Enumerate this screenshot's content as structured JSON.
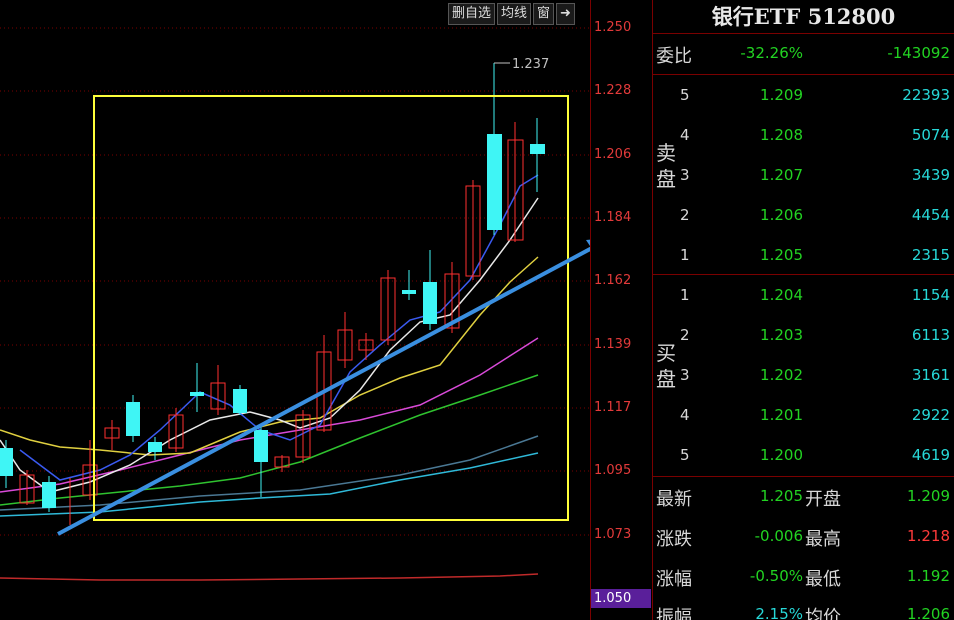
{
  "toolbar": {
    "buttons": [
      "删自选",
      "均线",
      "窗",
      "➜"
    ]
  },
  "price_axis": {
    "ticks": [
      "1.250",
      "1.228",
      "1.206",
      "1.184",
      "1.162",
      "1.139",
      "1.117",
      "1.095",
      "1.073",
      "1.050"
    ],
    "current_label": "1.050"
  },
  "chart": {
    "peak_label": "1.237",
    "colors": {
      "up": "#ff3030",
      "down": "#3ff5f5",
      "box": "#ffff3a",
      "arrow": "#3a8fe0"
    }
  },
  "quote": {
    "title": "银行ETF 512800",
    "weibi": {
      "label": "委比",
      "pct": "-32.26%",
      "diff": "-143092"
    },
    "sell_label": "卖盘",
    "buy_label": "买盘",
    "sell": [
      {
        "lvl": "5",
        "price": "1.209",
        "vol": "22393"
      },
      {
        "lvl": "4",
        "price": "1.208",
        "vol": "5074"
      },
      {
        "lvl": "3",
        "price": "1.207",
        "vol": "3439"
      },
      {
        "lvl": "2",
        "price": "1.206",
        "vol": "4454"
      },
      {
        "lvl": "1",
        "price": "1.205",
        "vol": "2315"
      }
    ],
    "buy": [
      {
        "lvl": "1",
        "price": "1.204",
        "vol": "1154"
      },
      {
        "lvl": "2",
        "price": "1.203",
        "vol": "6113"
      },
      {
        "lvl": "3",
        "price": "1.202",
        "vol": "3161"
      },
      {
        "lvl": "4",
        "price": "1.201",
        "vol": "2922"
      },
      {
        "lvl": "5",
        "price": "1.200",
        "vol": "4619"
      }
    ],
    "stats": [
      {
        "l1": "最新",
        "v1": "1.205",
        "l2": "开盘",
        "v2": "1.209"
      },
      {
        "l1": "涨跌",
        "v1": "-0.006",
        "l2": "最高",
        "v2": "1.218"
      },
      {
        "l1": "涨幅",
        "v1": "-0.50%",
        "l2": "最低",
        "v2": "1.192"
      },
      {
        "l1": "振幅",
        "v1": "2.15%",
        "l2": "均价",
        "v2": "1.206"
      }
    ]
  }
}
